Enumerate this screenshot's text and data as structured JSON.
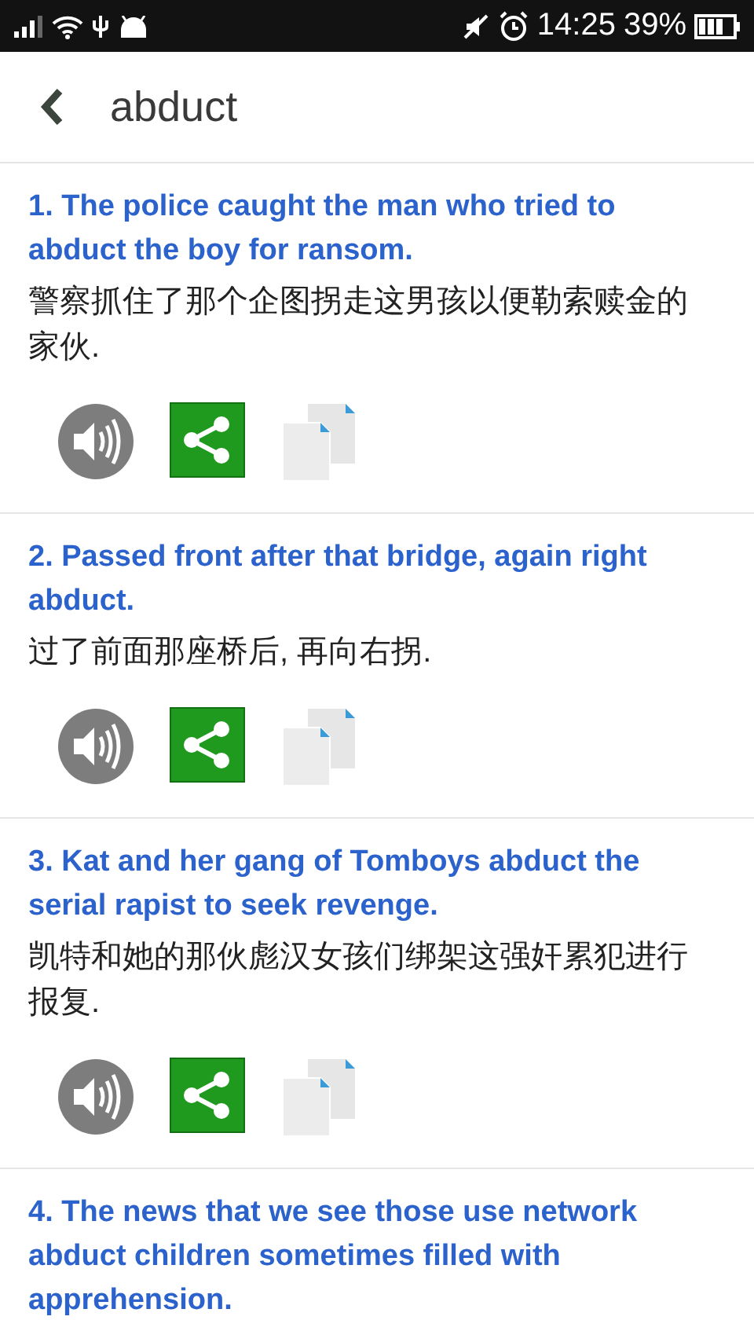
{
  "status_bar": {
    "time": "14:25",
    "battery": "39%"
  },
  "header": {
    "title": "abduct"
  },
  "examples": [
    {
      "english": "1. The police caught the man who tried to abduct the boy for ransom.",
      "chinese": "警察抓住了那个企图拐走这男孩以便勒索赎金的家伙.",
      "actions": true
    },
    {
      "english": "2. Passed front after that bridge, again right abduct.",
      "chinese": "过了前面那座桥后, 再向右拐.",
      "actions": true
    },
    {
      "english": "3. Kat and her gang of Tomboys abduct the serial rapist to seek revenge.",
      "chinese": "凯特和她的那伙彪汉女孩们绑架这强奸累犯进行报复.",
      "actions": true
    },
    {
      "english": "4. The news that we see those use network abduct children sometimes filled with apprehension.",
      "actions": false
    }
  ]
}
